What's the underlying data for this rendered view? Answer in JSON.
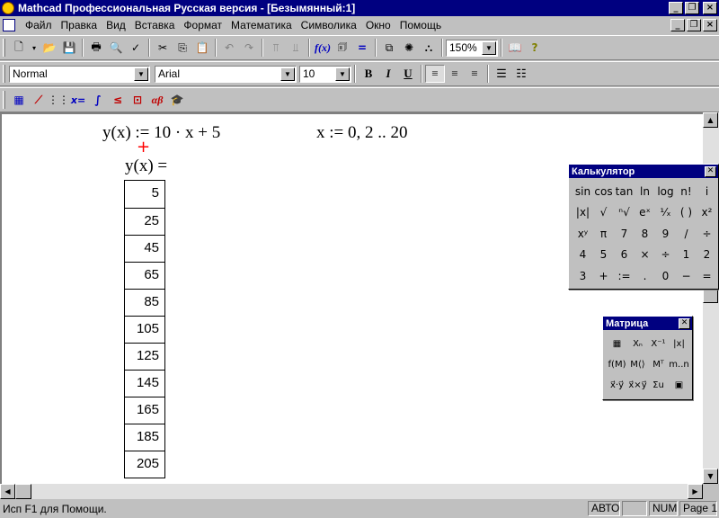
{
  "window": {
    "title": "Mathcad Профессиональная Русская версия - [Безымянный:1]",
    "minimize_glyph": "_",
    "restore_glyph": "❐",
    "close_glyph": "×"
  },
  "menu": [
    "Файл",
    "Правка",
    "Вид",
    "Вставка",
    "Формат",
    "Математика",
    "Символика",
    "Окно",
    "Помощь"
  ],
  "toolbar_standard": {
    "zoom": "150%"
  },
  "toolbar_format": {
    "style": "Normal",
    "font": "Arial",
    "size": "10",
    "bold": "B",
    "italic": "I",
    "underline": "U"
  },
  "math_toolbar": {
    "evaluation": "x=",
    "greek": "αβ"
  },
  "worksheet": {
    "definition_y": "y(x) := 10 · x + 5",
    "definition_x": "x := 0, 2 .. 20",
    "evaluation": "y(x) =",
    "results": [
      "5",
      "25",
      "45",
      "65",
      "85",
      "105",
      "125",
      "145",
      "165",
      "185",
      "205"
    ]
  },
  "calculator": {
    "title": "Калькулятор",
    "keys": [
      "sin",
      "cos",
      "tan",
      "ln",
      "log",
      "n!",
      "i",
      "|x|",
      "√",
      "ⁿ√",
      "eˣ",
      "¹⁄ₓ",
      "( )",
      "x²",
      "xʸ",
      "π",
      "7",
      "8",
      "9",
      "/",
      "÷",
      "4",
      "5",
      "6",
      "×",
      "÷",
      "1",
      "2",
      "3",
      "+",
      ":=",
      ".",
      "0",
      "−",
      "="
    ]
  },
  "matrix": {
    "title": "Матрица",
    "keys": [
      "▦",
      "Xₙ",
      "X⁻¹",
      "|x|",
      "f(M)",
      "M⟨⟩",
      "Mᵀ",
      "m..n",
      "x⃗·y⃗",
      "x⃗×y⃗",
      "Σu",
      "▣"
    ]
  },
  "status": {
    "help": "Исп F1 для Помощи.",
    "mode": "АВТО",
    "blank": "",
    "num": "NUM",
    "page": "Page 1"
  }
}
